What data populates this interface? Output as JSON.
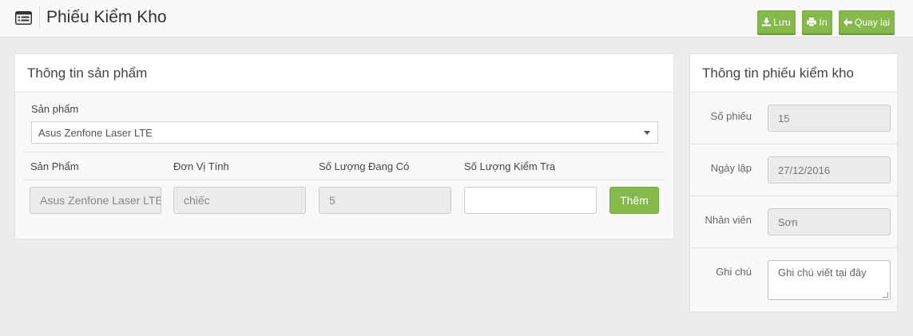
{
  "header": {
    "title": "Phiếu Kiểm Kho",
    "buttons": {
      "save": "Lưu",
      "print": "In",
      "back": "Quay lại"
    }
  },
  "product_panel": {
    "title": "Thông tin sản phẩm",
    "product_label": "Sản phẩm",
    "product_selected": "Asus Zenfone Laser LTE",
    "columns": [
      "Sản Phẩm",
      "Đơn Vị Tính",
      "Số Lượng Đang Có",
      "Số Lượng Kiểm Tra"
    ],
    "row": {
      "product": "Asus Zenfone Laser LTE",
      "unit": "chiếc",
      "qty_on_hand": "5",
      "qty_checked": ""
    },
    "add_button": "Thêm"
  },
  "voucher_panel": {
    "title": "Thông tin phiếu kiểm kho",
    "fields": [
      {
        "label": "Số phiếu",
        "value": "15"
      },
      {
        "label": "Ngày lập",
        "value": "27/12/2016"
      },
      {
        "label": "Nhân viên",
        "value": "Sơn"
      }
    ],
    "note_label": "Ghi chú",
    "note_placeholder": "Ghi chú viết tại đây"
  },
  "colors": {
    "accent": "#86b94b",
    "background": "#ececec"
  }
}
